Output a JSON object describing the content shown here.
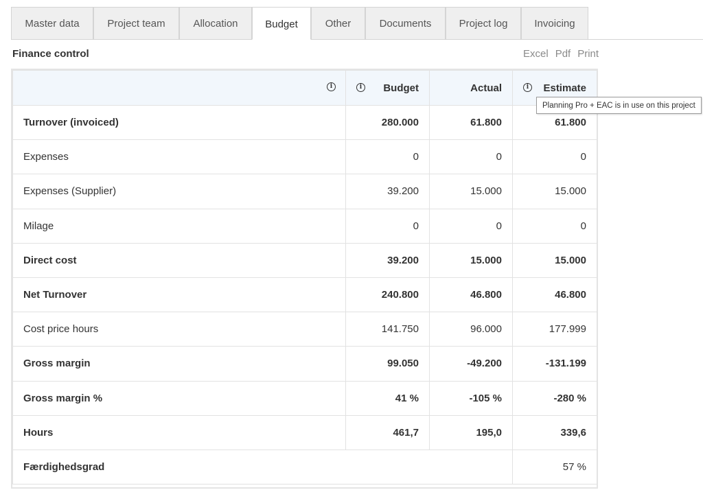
{
  "tabs": [
    {
      "label": "Master data"
    },
    {
      "label": "Project team"
    },
    {
      "label": "Allocation"
    },
    {
      "label": "Budget"
    },
    {
      "label": "Other"
    },
    {
      "label": "Documents"
    },
    {
      "label": "Project log"
    },
    {
      "label": "Invoicing"
    }
  ],
  "section": {
    "title": "Finance control",
    "exports": {
      "excel": "Excel",
      "pdf": "Pdf",
      "print": "Print"
    }
  },
  "table": {
    "headers": {
      "budget": "Budget",
      "actual": "Actual",
      "estimate": "Estimate"
    },
    "rows": [
      {
        "label": "Turnover (invoiced)",
        "budget": "280.000",
        "actual": "61.800",
        "estimate": "61.800"
      },
      {
        "label": "Expenses",
        "budget": "0",
        "actual": "0",
        "estimate": "0"
      },
      {
        "label": "Expenses (Supplier)",
        "budget": "39.200",
        "actual": "15.000",
        "estimate": "15.000"
      },
      {
        "label": "Milage",
        "budget": "0",
        "actual": "0",
        "estimate": "0"
      },
      {
        "label": "Direct cost",
        "budget": "39.200",
        "actual": "15.000",
        "estimate": "15.000"
      },
      {
        "label": "Net Turnover",
        "budget": "240.800",
        "actual": "46.800",
        "estimate": "46.800"
      },
      {
        "label": "Cost price hours",
        "budget": "141.750",
        "actual": "96.000",
        "estimate": "177.999"
      },
      {
        "label": "Gross margin",
        "budget": "99.050",
        "actual": "-49.200",
        "estimate": "-131.199"
      },
      {
        "label": "Gross margin %",
        "budget": "41 %",
        "actual": "-105 %",
        "estimate": "-280 %"
      },
      {
        "label": "Hours",
        "budget": "461,7",
        "actual": "195,0",
        "estimate": "339,6"
      },
      {
        "label": "Færdighedsgrad",
        "estimate": "57 %"
      }
    ]
  },
  "tooltip": {
    "text": "Planning Pro + EAC is in use on this project"
  },
  "icons": {
    "info": "info-icon"
  }
}
